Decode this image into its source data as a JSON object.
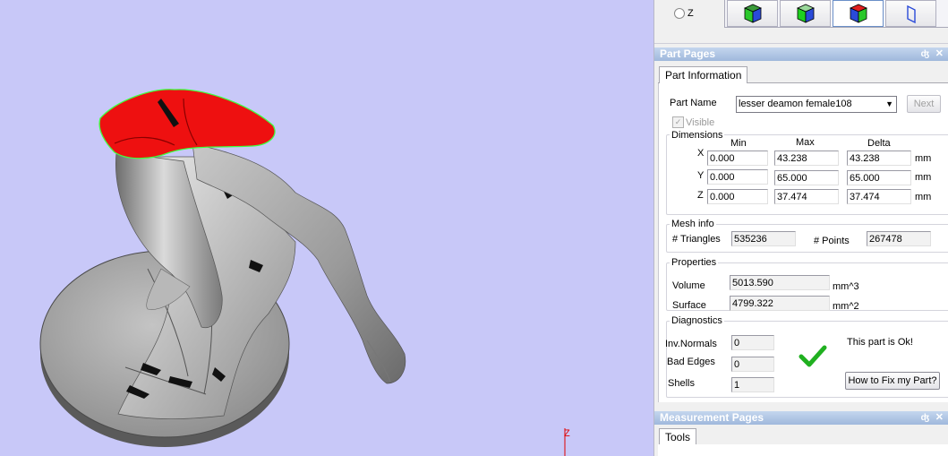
{
  "view_controls": {
    "radio_z_label": "Z",
    "buttons": [
      {
        "name": "view-iso-button",
        "icon": "green-blue-cube-icon"
      },
      {
        "name": "view-front-button",
        "icon": "green-cube-icon"
      },
      {
        "name": "view-side-button",
        "icon": "red-blue-cube-icon"
      },
      {
        "name": "view-outline-button",
        "icon": "blue-outline-icon"
      }
    ]
  },
  "axis_label": "Z",
  "part_pages": {
    "title": "Part Pages",
    "tab": "Part Information",
    "part_name_label": "Part Name",
    "part_name_value": "lesser deamon female108",
    "next_button": "Next",
    "visible_label": "Visible",
    "dimensions": {
      "label": "Dimensions",
      "headers": [
        "Min",
        "Max",
        "Delta"
      ],
      "rows": [
        {
          "axis": "X",
          "min": "0.000",
          "max": "43.238",
          "delta": "43.238",
          "unit": "mm"
        },
        {
          "axis": "Y",
          "min": "0.000",
          "max": "65.000",
          "delta": "65.000",
          "unit": "mm"
        },
        {
          "axis": "Z",
          "min": "0.000",
          "max": "37.474",
          "delta": "37.474",
          "unit": "mm"
        }
      ]
    },
    "mesh_info": {
      "label": "Mesh info",
      "triangles_label": "# Triangles",
      "triangles_value": "535236",
      "points_label": "# Points",
      "points_value": "267478"
    },
    "properties": {
      "label": "Properties",
      "volume_label": "Volume",
      "volume_value": "5013.590",
      "volume_unit": "mm^3",
      "surface_label": "Surface",
      "surface_value": "4799.322",
      "surface_unit": "mm^2"
    },
    "diagnostics": {
      "label": "Diagnostics",
      "inv_normals_label": "Inv.Normals",
      "inv_normals_value": "0",
      "bad_edges_label": "Bad Edges",
      "bad_edges_value": "0",
      "shells_label": "Shells",
      "shells_value": "1",
      "status_text": "This part is Ok!",
      "fix_button": "How to Fix my Part?"
    }
  },
  "measurement_pages": {
    "title": "Measurement Pages",
    "tab": "Tools"
  },
  "header_pin_icon": "pin-icon",
  "header_close_icon": "close-icon",
  "colors": {
    "viewport_bg": "#c8c8f8",
    "model_gray": "#9a9a9a",
    "highlight_red": "#ee1010",
    "highlight_outline": "#40ff40",
    "ok_green": "#20b020"
  }
}
